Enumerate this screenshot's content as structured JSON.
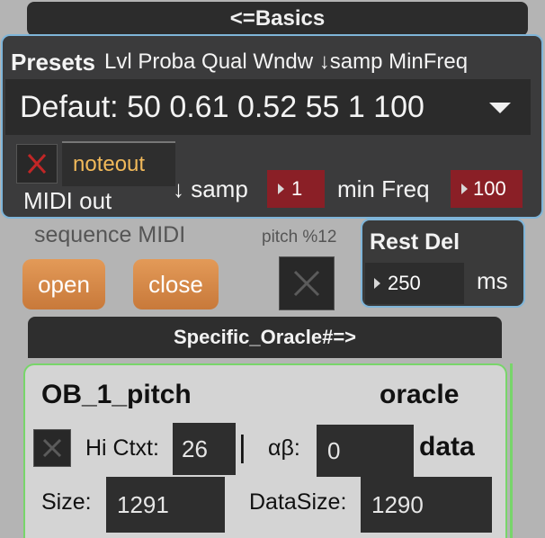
{
  "basics_button": "<=Basics",
  "presets": {
    "title": "Presets",
    "columns": "Lvl Proba Qual Wndw ↓samp MinFreq",
    "selected": "Defaut: 50 0.61 0.52 55 1 100"
  },
  "midi": {
    "noteout_label": "noteout",
    "midi_out_label": "MIDI out",
    "samp_label": "↓ samp",
    "samp_value": "1",
    "min_freq_label": "min Freq",
    "min_freq_value": "100",
    "sequence_label": "sequence MIDI",
    "open_label": "open",
    "close_label": "close",
    "pitch_label": "pitch %12"
  },
  "rest": {
    "title": "Rest Del",
    "value": "250",
    "unit": "ms"
  },
  "oracle_header": "Specific_Oracle#=>",
  "oracle": {
    "name": "OB_1_pitch",
    "label_oracle": "oracle",
    "label_data": "data",
    "hi_ctxt_label": "Hi Ctxt:",
    "hi_ctxt_value": "26",
    "separator": "|",
    "alpha_beta_label": "αβ:",
    "alpha_beta_value": "0",
    "size_label": "Size:",
    "size_value": "1291",
    "datasize_label": "DataSize:",
    "datasize_value": "1290"
  },
  "colors": {
    "accent_blue": "#7fb5d9",
    "accent_green": "#78d56a",
    "toggle_red": "#c12626",
    "number_red": "#8a1f26",
    "button_orange": "#d88a48",
    "noteout_text": "#f1b95a"
  },
  "icons": {
    "midi_toggle": "x-icon",
    "pitch_toggle": "x-icon",
    "oracle_toggle": "x-icon",
    "dropdown": "triangle-down-icon",
    "number_caret": "triangle-right-icon"
  }
}
